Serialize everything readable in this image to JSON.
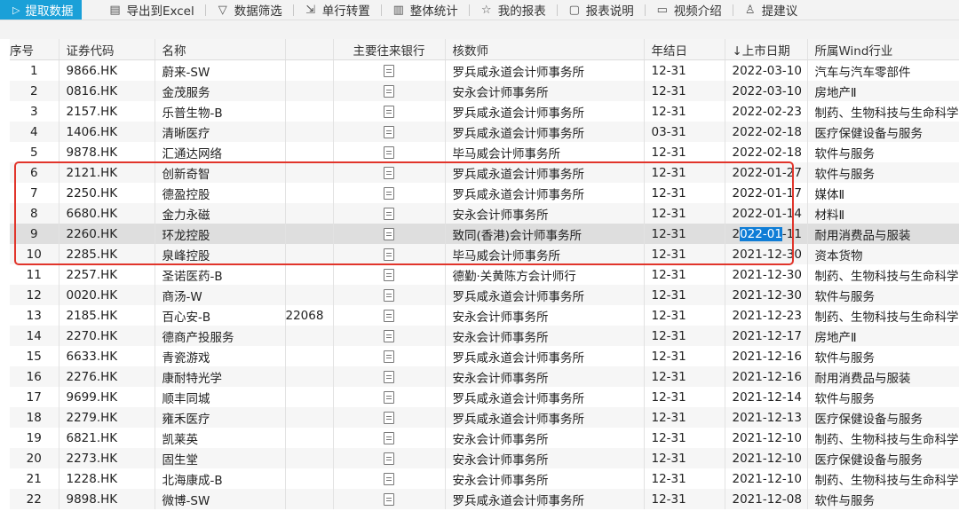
{
  "toolbar": {
    "extract": "提取数据",
    "export_excel": "导出到Excel",
    "filter": "数据筛选",
    "transpose": "单行转置",
    "stats": "整体统计",
    "my_reports": "我的报表",
    "report_desc": "报表说明",
    "video": "视频介绍",
    "suggest": "提建议"
  },
  "table": {
    "headers": {
      "idx": "序号",
      "code": "证券代码",
      "name": "名称",
      "bank": "主要往来银行",
      "auditor": "核数师",
      "fye": "年结日",
      "listing": "↓上市日期",
      "industry": "所属Wind行业"
    },
    "rows": [
      {
        "idx": "1",
        "code": "9866.HK",
        "name": "蔚来-SW",
        "extra": "",
        "auditor": "罗兵咸永道会计师事务所",
        "fye": "12-31",
        "listing": "2022-03-10",
        "industry": "汽车与汽车零部件"
      },
      {
        "idx": "2",
        "code": "0816.HK",
        "name": "金茂服务",
        "extra": "",
        "auditor": "安永会计师事务所",
        "fye": "12-31",
        "listing": "2022-03-10",
        "industry": "房地产Ⅱ"
      },
      {
        "idx": "3",
        "code": "2157.HK",
        "name": "乐普生物-B",
        "extra": "",
        "auditor": "罗兵咸永道会计师事务所",
        "fye": "12-31",
        "listing": "2022-02-23",
        "industry": "制药、生物科技与生命科学"
      },
      {
        "idx": "4",
        "code": "1406.HK",
        "name": "清晰医疗",
        "extra": "",
        "auditor": "罗兵咸永道会计师事务所",
        "fye": "03-31",
        "listing": "2022-02-18",
        "industry": "医疗保健设备与服务"
      },
      {
        "idx": "5",
        "code": "9878.HK",
        "name": "汇通达网络",
        "extra": "",
        "auditor": "毕马威会计师事务所",
        "fye": "12-31",
        "listing": "2022-02-18",
        "industry": "软件与服务"
      },
      {
        "idx": "6",
        "code": "2121.HK",
        "name": "创新奇智",
        "extra": "",
        "auditor": "罗兵咸永道会计师事务所",
        "fye": "12-31",
        "listing": "2022-01-27",
        "industry": "软件与服务"
      },
      {
        "idx": "7",
        "code": "2250.HK",
        "name": "德盈控股",
        "extra": "",
        "auditor": "罗兵咸永道会计师事务所",
        "fye": "12-31",
        "listing": "2022-01-17",
        "industry": "媒体Ⅱ"
      },
      {
        "idx": "8",
        "code": "6680.HK",
        "name": "金力永磁",
        "extra": "",
        "auditor": "安永会计师事务所",
        "fye": "12-31",
        "listing": "2022-01-14",
        "industry": "材料Ⅱ"
      },
      {
        "idx": "9",
        "code": "2260.HK",
        "name": "环龙控股",
        "extra": "",
        "auditor": "致同(香港)会计师事务所",
        "fye": "12-31",
        "listing": "2022-01-11",
        "industry": "耐用消费品与服装"
      },
      {
        "idx": "10",
        "code": "2285.HK",
        "name": "泉峰控股",
        "extra": "",
        "auditor": "毕马威会计师事务所",
        "fye": "12-31",
        "listing": "2021-12-30",
        "industry": "资本货物"
      },
      {
        "idx": "11",
        "code": "2257.HK",
        "name": "圣诺医药-B",
        "extra": "",
        "auditor": "德勤·关黄陈方会计师行",
        "fye": "12-31",
        "listing": "2021-12-30",
        "industry": "制药、生物科技与生命科学"
      },
      {
        "idx": "12",
        "code": "0020.HK",
        "name": "商汤-W",
        "extra": "",
        "auditor": "罗兵咸永道会计师事务所",
        "fye": "12-31",
        "listing": "2021-12-30",
        "industry": "软件与服务"
      },
      {
        "idx": "13",
        "code": "2185.HK",
        "name": "百心安-B",
        "extra": "22068",
        "auditor": "安永会计师事务所",
        "fye": "12-31",
        "listing": "2021-12-23",
        "industry": "制药、生物科技与生命科学"
      },
      {
        "idx": "14",
        "code": "2270.HK",
        "name": "德商产投服务",
        "extra": "",
        "auditor": "安永会计师事务所",
        "fye": "12-31",
        "listing": "2021-12-17",
        "industry": "房地产Ⅱ"
      },
      {
        "idx": "15",
        "code": "6633.HK",
        "name": "青瓷游戏",
        "extra": "",
        "auditor": "罗兵咸永道会计师事务所",
        "fye": "12-31",
        "listing": "2021-12-16",
        "industry": "软件与服务"
      },
      {
        "idx": "16",
        "code": "2276.HK",
        "name": "康耐特光学",
        "extra": "",
        "auditor": "安永会计师事务所",
        "fye": "12-31",
        "listing": "2021-12-16",
        "industry": "耐用消费品与服装"
      },
      {
        "idx": "17",
        "code": "9699.HK",
        "name": "顺丰同城",
        "extra": "",
        "auditor": "罗兵咸永道会计师事务所",
        "fye": "12-31",
        "listing": "2021-12-14",
        "industry": "软件与服务"
      },
      {
        "idx": "18",
        "code": "2279.HK",
        "name": "雍禾医疗",
        "extra": "",
        "auditor": "罗兵咸永道会计师事务所",
        "fye": "12-31",
        "listing": "2021-12-13",
        "industry": "医疗保健设备与服务"
      },
      {
        "idx": "19",
        "code": "6821.HK",
        "name": "凯莱英",
        "extra": "",
        "auditor": "安永会计师事务所",
        "fye": "12-31",
        "listing": "2021-12-10",
        "industry": "制药、生物科技与生命科学"
      },
      {
        "idx": "20",
        "code": "2273.HK",
        "name": "固生堂",
        "extra": "",
        "auditor": "安永会计师事务所",
        "fye": "12-31",
        "listing": "2021-12-10",
        "industry": "医疗保健设备与服务"
      },
      {
        "idx": "21",
        "code": "1228.HK",
        "name": "北海康成-B",
        "extra": "",
        "auditor": "安永会计师事务所",
        "fye": "12-31",
        "listing": "2021-12-10",
        "industry": "制药、生物科技与生命科学"
      },
      {
        "idx": "22",
        "code": "9898.HK",
        "name": "微博-SW",
        "extra": "",
        "auditor": "罗兵咸永道会计师事务所",
        "fye": "12-31",
        "listing": "2021-12-08",
        "industry": "软件与服务"
      }
    ],
    "selected_row": 9,
    "selection": {
      "before": "2",
      "highlight": "022-01",
      "after": "-11"
    }
  }
}
